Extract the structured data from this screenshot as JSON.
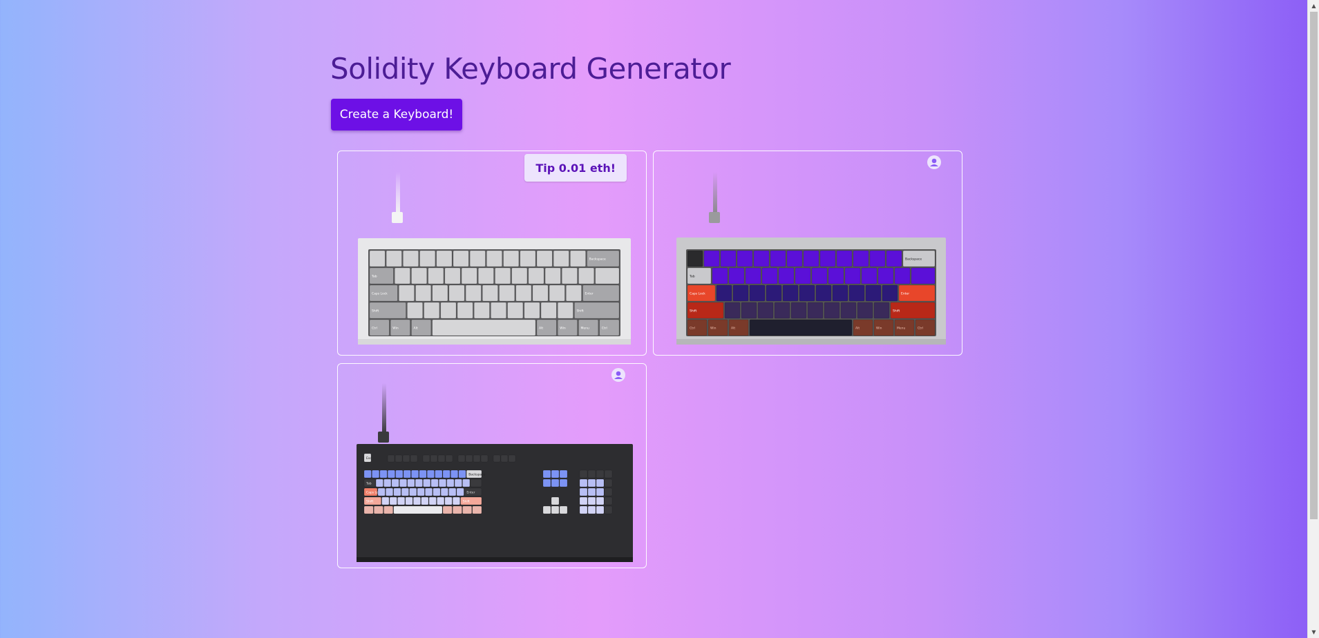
{
  "page": {
    "title": "Solidity Keyboard Generator",
    "create_button_label": "Create a Keyboard!"
  },
  "keyboards": [
    {
      "layout": "60%",
      "theme": "white",
      "action": "tip",
      "action_label": "Tip 0.01 eth!",
      "case_color": "#e8e8ea",
      "key_color": "#cfcfd1",
      "accent_color": "#9a9a9c",
      "legends": [
        "Backspace",
        "Tab",
        "Caps Lock",
        "Enter",
        "Shift",
        "Shift",
        "Ctrl",
        "Win",
        "Alt",
        "Alt",
        "Win",
        "Menu",
        "Ctrl"
      ]
    },
    {
      "layout": "60%",
      "theme": "purple-red",
      "action": "owner",
      "action_icon": "user-circle-icon",
      "case_color": "#c9c9cc",
      "key_color": "#5b10d8",
      "accent_color": "#e8462a",
      "legends": [
        "Backspace",
        "Tab",
        "Caps Lock",
        "Enter",
        "Shift",
        "Shift",
        "Ctrl",
        "Win",
        "Alt",
        "Alt",
        "Win",
        "Menu",
        "Ctrl"
      ]
    },
    {
      "layout": "100%",
      "theme": "blue-pink",
      "action": "owner",
      "action_icon": "user-circle-icon",
      "case_color": "#2d2d30",
      "key_color": "#b8bff5",
      "accent_color": "#f0806a",
      "legends": [
        "Esc",
        "Backspace",
        "Tab",
        "Caps Lock",
        "Enter",
        "Shift",
        "Shift"
      ]
    }
  ]
}
